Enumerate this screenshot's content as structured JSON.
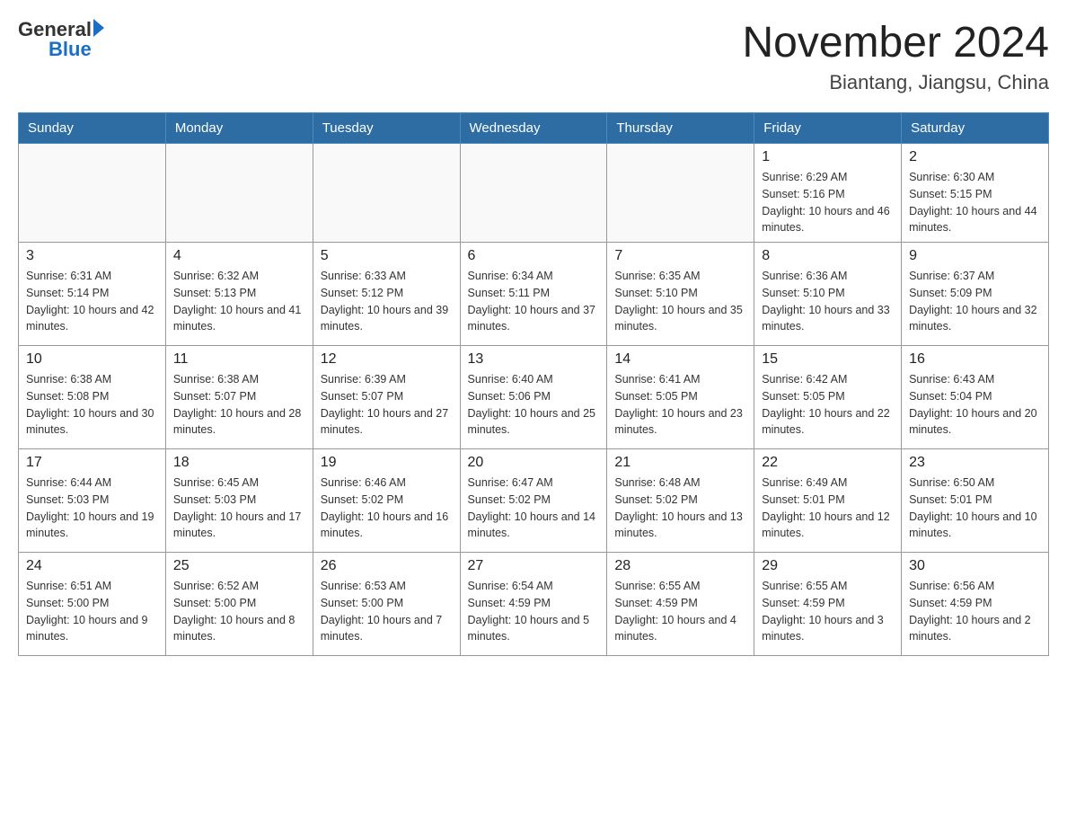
{
  "header": {
    "logo_general": "General",
    "logo_blue": "Blue",
    "month_title": "November 2024",
    "location": "Biantang, Jiangsu, China"
  },
  "weekdays": [
    "Sunday",
    "Monday",
    "Tuesday",
    "Wednesday",
    "Thursday",
    "Friday",
    "Saturday"
  ],
  "weeks": [
    [
      {
        "day": "",
        "info": ""
      },
      {
        "day": "",
        "info": ""
      },
      {
        "day": "",
        "info": ""
      },
      {
        "day": "",
        "info": ""
      },
      {
        "day": "",
        "info": ""
      },
      {
        "day": "1",
        "info": "Sunrise: 6:29 AM\nSunset: 5:16 PM\nDaylight: 10 hours and 46 minutes."
      },
      {
        "day": "2",
        "info": "Sunrise: 6:30 AM\nSunset: 5:15 PM\nDaylight: 10 hours and 44 minutes."
      }
    ],
    [
      {
        "day": "3",
        "info": "Sunrise: 6:31 AM\nSunset: 5:14 PM\nDaylight: 10 hours and 42 minutes."
      },
      {
        "day": "4",
        "info": "Sunrise: 6:32 AM\nSunset: 5:13 PM\nDaylight: 10 hours and 41 minutes."
      },
      {
        "day": "5",
        "info": "Sunrise: 6:33 AM\nSunset: 5:12 PM\nDaylight: 10 hours and 39 minutes."
      },
      {
        "day": "6",
        "info": "Sunrise: 6:34 AM\nSunset: 5:11 PM\nDaylight: 10 hours and 37 minutes."
      },
      {
        "day": "7",
        "info": "Sunrise: 6:35 AM\nSunset: 5:10 PM\nDaylight: 10 hours and 35 minutes."
      },
      {
        "day": "8",
        "info": "Sunrise: 6:36 AM\nSunset: 5:10 PM\nDaylight: 10 hours and 33 minutes."
      },
      {
        "day": "9",
        "info": "Sunrise: 6:37 AM\nSunset: 5:09 PM\nDaylight: 10 hours and 32 minutes."
      }
    ],
    [
      {
        "day": "10",
        "info": "Sunrise: 6:38 AM\nSunset: 5:08 PM\nDaylight: 10 hours and 30 minutes."
      },
      {
        "day": "11",
        "info": "Sunrise: 6:38 AM\nSunset: 5:07 PM\nDaylight: 10 hours and 28 minutes."
      },
      {
        "day": "12",
        "info": "Sunrise: 6:39 AM\nSunset: 5:07 PM\nDaylight: 10 hours and 27 minutes."
      },
      {
        "day": "13",
        "info": "Sunrise: 6:40 AM\nSunset: 5:06 PM\nDaylight: 10 hours and 25 minutes."
      },
      {
        "day": "14",
        "info": "Sunrise: 6:41 AM\nSunset: 5:05 PM\nDaylight: 10 hours and 23 minutes."
      },
      {
        "day": "15",
        "info": "Sunrise: 6:42 AM\nSunset: 5:05 PM\nDaylight: 10 hours and 22 minutes."
      },
      {
        "day": "16",
        "info": "Sunrise: 6:43 AM\nSunset: 5:04 PM\nDaylight: 10 hours and 20 minutes."
      }
    ],
    [
      {
        "day": "17",
        "info": "Sunrise: 6:44 AM\nSunset: 5:03 PM\nDaylight: 10 hours and 19 minutes."
      },
      {
        "day": "18",
        "info": "Sunrise: 6:45 AM\nSunset: 5:03 PM\nDaylight: 10 hours and 17 minutes."
      },
      {
        "day": "19",
        "info": "Sunrise: 6:46 AM\nSunset: 5:02 PM\nDaylight: 10 hours and 16 minutes."
      },
      {
        "day": "20",
        "info": "Sunrise: 6:47 AM\nSunset: 5:02 PM\nDaylight: 10 hours and 14 minutes."
      },
      {
        "day": "21",
        "info": "Sunrise: 6:48 AM\nSunset: 5:02 PM\nDaylight: 10 hours and 13 minutes."
      },
      {
        "day": "22",
        "info": "Sunrise: 6:49 AM\nSunset: 5:01 PM\nDaylight: 10 hours and 12 minutes."
      },
      {
        "day": "23",
        "info": "Sunrise: 6:50 AM\nSunset: 5:01 PM\nDaylight: 10 hours and 10 minutes."
      }
    ],
    [
      {
        "day": "24",
        "info": "Sunrise: 6:51 AM\nSunset: 5:00 PM\nDaylight: 10 hours and 9 minutes."
      },
      {
        "day": "25",
        "info": "Sunrise: 6:52 AM\nSunset: 5:00 PM\nDaylight: 10 hours and 8 minutes."
      },
      {
        "day": "26",
        "info": "Sunrise: 6:53 AM\nSunset: 5:00 PM\nDaylight: 10 hours and 7 minutes."
      },
      {
        "day": "27",
        "info": "Sunrise: 6:54 AM\nSunset: 4:59 PM\nDaylight: 10 hours and 5 minutes."
      },
      {
        "day": "28",
        "info": "Sunrise: 6:55 AM\nSunset: 4:59 PM\nDaylight: 10 hours and 4 minutes."
      },
      {
        "day": "29",
        "info": "Sunrise: 6:55 AM\nSunset: 4:59 PM\nDaylight: 10 hours and 3 minutes."
      },
      {
        "day": "30",
        "info": "Sunrise: 6:56 AM\nSunset: 4:59 PM\nDaylight: 10 hours and 2 minutes."
      }
    ]
  ]
}
